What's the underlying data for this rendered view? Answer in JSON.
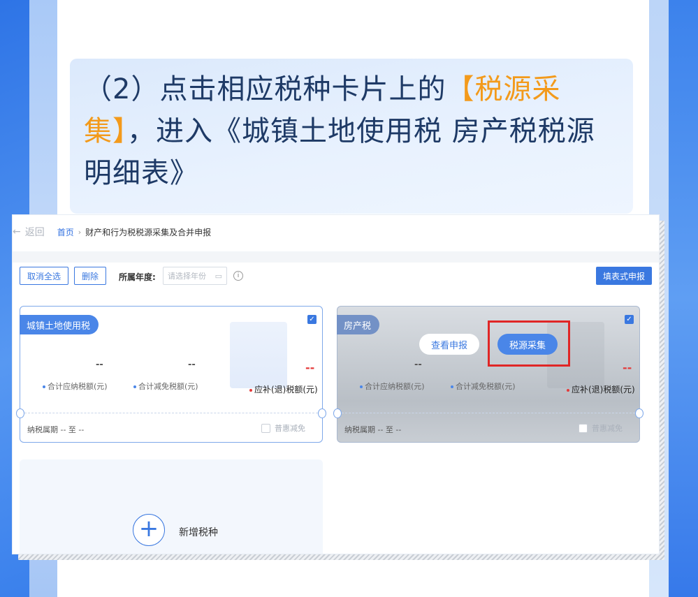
{
  "hero": {
    "prefix": "（2）点击相应税种卡片上的",
    "highlight": "【税源采集】",
    "suffix": "，进入《城镇土地使用税 房产税税源明细表》"
  },
  "screenshot": {
    "back_label": "返回",
    "breadcrumb": {
      "home": "首页",
      "current": "财产和行为税税源采集及合并申报"
    },
    "toolbar": {
      "deselect_all": "取消全选",
      "delete": "删除",
      "year_label": "所属年度:",
      "year_placeholder": "请选择年份",
      "submit": "填表式申报"
    },
    "cards": [
      {
        "tag": "城镇土地使用税",
        "val_due": "--",
        "lbl_due": "合计应纳税额(元)",
        "val_relief": "--",
        "lbl_relief": "合计减免税额(元)",
        "val_payable": "--",
        "lbl_payable": "应补(退)税额(元)",
        "period": "纳税属期 -- 至 --",
        "preferential": "普惠减免"
      },
      {
        "tag": "房产税",
        "btn_view": "查看申报",
        "btn_collect": "税源采集",
        "val_due": "--",
        "lbl_due": "合计应纳税额(元)",
        "lbl_relief": "合计减免税额(元)",
        "val_payable": "--",
        "lbl_payable": "应补(退)税额(元)",
        "period": "纳税属期 -- 至 --",
        "preferential": "普惠减免"
      }
    ],
    "add_tax": "新增税种"
  },
  "colors": {
    "accent": "#3a78e0",
    "highlight": "#f39a1b",
    "alert": "#e02626"
  }
}
